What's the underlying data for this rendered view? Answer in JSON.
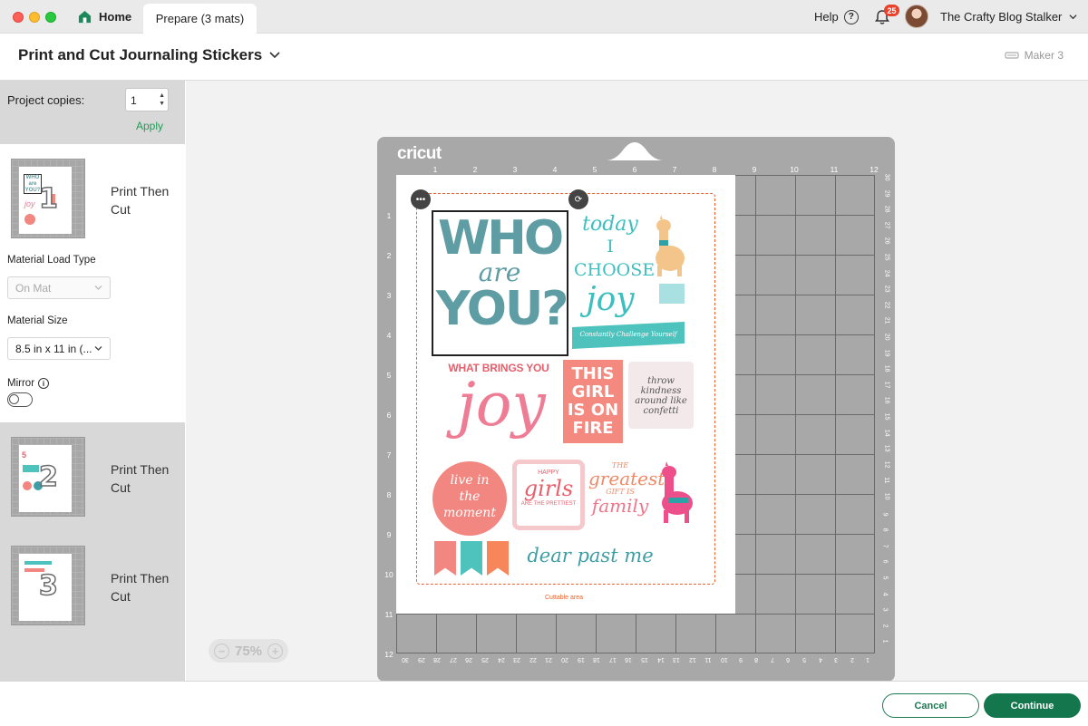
{
  "titlebar": {
    "home_label": "Home",
    "active_tab_label": "Prepare (3 mats)",
    "help_label": "Help",
    "help_icon_glyph": "?",
    "notification_count": "25",
    "user_name": "The Crafty Blog Stalker"
  },
  "header": {
    "project_title": "Print and Cut Journaling Stickers",
    "machine_name": "Maker 3"
  },
  "sidebar": {
    "copies_label": "Project copies:",
    "copies_value": "1",
    "apply_label": "Apply",
    "material_load_type_label": "Material Load Type",
    "material_load_type_value": "On Mat",
    "material_size_label": "Material Size",
    "material_size_value": "8.5 in x 11 in (...",
    "mirror_label": "Mirror",
    "mirror_enabled": false,
    "mats": [
      {
        "number": "1",
        "label": "Print Then Cut",
        "selected": true
      },
      {
        "number": "2",
        "label": "Print Then Cut",
        "selected": false
      },
      {
        "number": "3",
        "label": "Print Then Cut",
        "selected": false
      }
    ]
  },
  "canvas": {
    "brand": "cricut",
    "ruler_top": [
      "1",
      "2",
      "3",
      "4",
      "5",
      "6",
      "7",
      "8",
      "9",
      "10",
      "11",
      "12"
    ],
    "ruler_left": [
      "1",
      "2",
      "3",
      "4",
      "5",
      "6",
      "7",
      "8",
      "9",
      "10",
      "11",
      "12"
    ],
    "ruler_right": [
      "30",
      "29",
      "28",
      "27",
      "26",
      "25",
      "24",
      "23",
      "22",
      "21",
      "20",
      "19",
      "18",
      "17",
      "16",
      "15",
      "14",
      "13",
      "12",
      "11",
      "10",
      "9",
      "8",
      "7",
      "6",
      "5",
      "4",
      "3",
      "2",
      "1"
    ],
    "ruler_bottom": [
      "30",
      "29",
      "28",
      "27",
      "26",
      "25",
      "24",
      "23",
      "22",
      "21",
      "20",
      "19",
      "18",
      "17",
      "16",
      "15",
      "14",
      "13",
      "12",
      "11",
      "10",
      "9",
      "8",
      "7",
      "6",
      "5",
      "4",
      "3",
      "2",
      "1"
    ],
    "cuttable_area_label": "Cuttable area",
    "more_icon_glyph": "•••",
    "rotate_icon_glyph": "⟳",
    "zoom_level": "75%",
    "zoom_out_glyph": "−",
    "zoom_in_glyph": "+",
    "stickers": {
      "who_line1": "WHO",
      "who_line2": "are",
      "who_line3": "YOU?",
      "today_line1": "today",
      "today_line2": "I CHOOSE",
      "today_line3": "joy",
      "banner_text": "Constantly Challenge Yourself",
      "what_brings": "WHAT BRINGS YOU",
      "joy": "joy",
      "girl_line1": "THIS",
      "girl_line2": "GIRL",
      "girl_line3": "IS ON",
      "girl_line4": "FIRE",
      "laurel_text": "throw kindness around like confetti",
      "live_line1": "live in",
      "live_line2": "the",
      "live_line3": "moment",
      "happy_line1": "HAPPY",
      "happy_line2": "girls",
      "happy_line3": "ARE THE PRETTIEST",
      "greatest_line1": "THE",
      "greatest_line2": "greatest",
      "greatest_line3": "GIFT IS",
      "greatest_line4": "family",
      "dear_past_me": "dear past me"
    }
  },
  "footer": {
    "cancel_label": "Cancel",
    "continue_label": "Continue"
  },
  "colors": {
    "primary": "#13764c",
    "apply_green": "#1f9d55",
    "badge_red": "#e8412c",
    "cut_line": "#e8622d",
    "mat_gray": "#a8a8a8"
  }
}
